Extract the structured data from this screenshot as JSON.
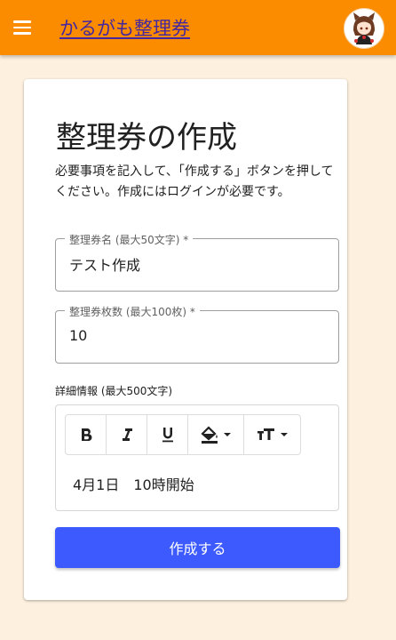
{
  "appbar": {
    "title": "かるがも整理券",
    "menu_icon": "hamburger-menu-icon",
    "avatar_icon": "user-avatar-icon",
    "background": "#fb8c00",
    "title_color": "#4527a0"
  },
  "form": {
    "heading": "整理券の作成",
    "description": "必要事項を記入して、「作成する」ボタンを押してください。作成にはログインが必要です。",
    "name_field": {
      "label": "整理券名 (最大50文字) *",
      "value": "テスト作成"
    },
    "count_field": {
      "label": "整理券枚数 (最大100枚) *",
      "value": "10"
    },
    "detail_label": "詳細情報 (最大500文字)",
    "editor": {
      "toolbar": [
        "bold-icon",
        "italic-icon",
        "underline-icon",
        "fill-color-icon",
        "text-size-icon"
      ],
      "content": "4月1日　10時開始"
    },
    "submit_label": "作成する",
    "submit_color": "#3d5afe"
  }
}
